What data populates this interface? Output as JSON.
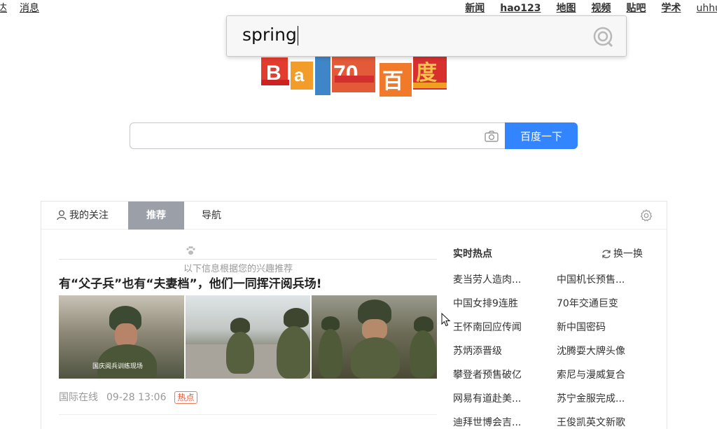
{
  "top_nav": {
    "left": [
      "达",
      "消息"
    ],
    "right": [
      "新闻",
      "hao123",
      "地图",
      "视频",
      "贴吧",
      "学术",
      "uhhu"
    ]
  },
  "popup": {
    "text": "spring",
    "icon": "voice-search-icon"
  },
  "logo": {
    "alt": "Bai度 70 百度"
  },
  "search": {
    "placeholder": "",
    "camera_icon": "camera-icon",
    "button_label": "百度一下"
  },
  "tabs": {
    "follow": "我的关注",
    "recommend": "推荐",
    "nav": "导航",
    "settings_icon": "gear-icon"
  },
  "feed": {
    "hint": "以下信息根据您的兴趣推荐",
    "headline": "有“父子兵”也有“夫妻档”，他们一同挥汗阅兵场!",
    "image_caption": "国庆阅兵训练现场",
    "source": "国际在线",
    "time": "09-28 13:06",
    "badge": "热点"
  },
  "hot": {
    "title": "实时热点",
    "refresh": "换一换",
    "col1": [
      "麦当劳人造肉...",
      "中国女排9连胜",
      "王怀南回应传闻",
      "苏炳添晋级",
      "攀登者预售破亿",
      "网易有道赴美...",
      "迪拜世博会吉..."
    ],
    "col2": [
      "中国机长预售...",
      "70年交通巨变",
      "新中国密码",
      "沈腾耍大牌头像",
      "索尼与漫威复合",
      "苏宁金服完成...",
      "王俊凯英文新歌"
    ]
  },
  "colors": {
    "accent": "#3385ff",
    "tab_active": "#9a9fa8",
    "badge": "#f0522d"
  }
}
